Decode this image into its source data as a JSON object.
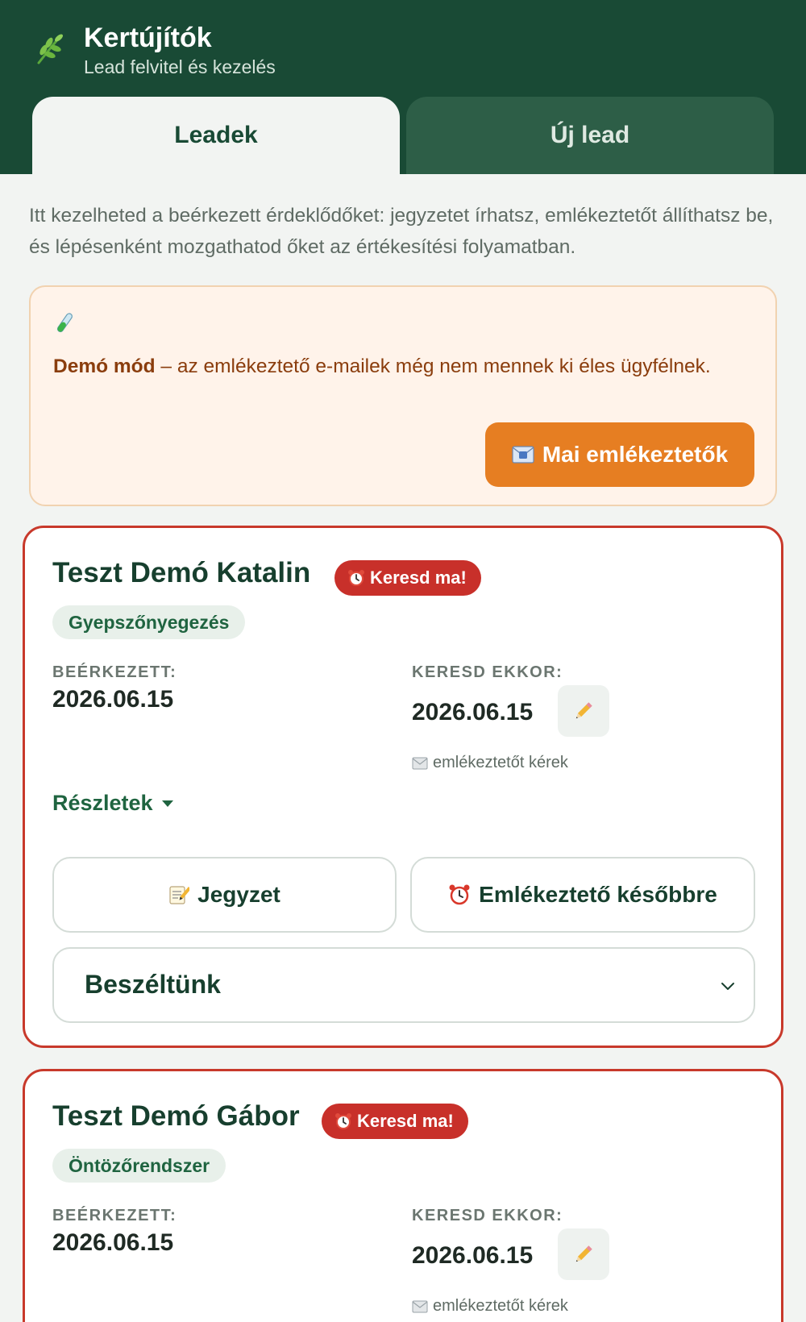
{
  "header": {
    "title": "Kertújítók",
    "subtitle": "Lead felvitel és kezelés",
    "logo_icon": "leaf-icon"
  },
  "tabs": [
    {
      "label": "Leadek",
      "active": true
    },
    {
      "label": "Új lead",
      "active": false
    }
  ],
  "intro_text": "Itt kezelheted a beérkezett érdeklődőket: jegyzetet írhatsz, emlékeztetőt állíthatsz be, és lépésenként mozgathatod őket az értékesítési folyamatban.",
  "demo_notice": {
    "icon": "test-tube-icon",
    "bold": "Demó mód",
    "text": " – az emlékeztető e-mailek még nem mennek ki éles ügyfélnek.",
    "button_label": "Mai emlékeztetők",
    "button_icon": "email-icon"
  },
  "leads": [
    {
      "name": "Teszt Demó Katalin",
      "badge": "Keresd ma!",
      "service": "Gyepszőnyegezés",
      "received_label": "BEÉRKEZETT:",
      "received_date": "2026.06.15",
      "callback_label": "KERESD EKKOR:",
      "callback_date": "2026.06.15",
      "reminder_note": "emlékeztetőt kérek",
      "details_label": "Részletek",
      "note_button": "Jegyzet",
      "later_button": "Emlékeztető későbbre",
      "status": "Beszéltünk"
    },
    {
      "name": "Teszt Demó Gábor",
      "badge": "Keresd ma!",
      "service": "Öntözőrendszer",
      "received_label": "BEÉRKEZETT:",
      "received_date": "2026.06.15",
      "callback_label": "KERESD EKKOR:",
      "callback_date": "2026.06.15",
      "reminder_note": "emlékeztetőt kérek"
    }
  ],
  "colors": {
    "header_bg": "#194a35",
    "urgent_red": "#c8392b",
    "orange": "#e67e22",
    "demo_bg": "#fff3ea"
  }
}
